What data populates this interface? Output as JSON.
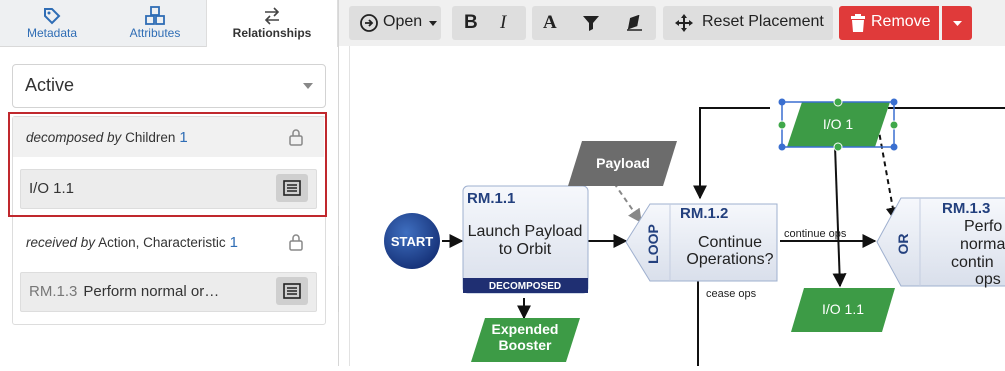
{
  "tabs": [
    {
      "label": "Metadata",
      "icon": "tag-icon"
    },
    {
      "label": "Attributes",
      "icon": "cubes-icon"
    },
    {
      "label": "Relationships",
      "icon": "swap-arrows-icon",
      "active": true
    }
  ],
  "filter": {
    "selected": "Active"
  },
  "relationships": [
    {
      "verb": "decomposed by",
      "target": "Children",
      "count": "1",
      "items": [
        {
          "id": "",
          "name": "I/O 1.1"
        }
      ]
    },
    {
      "verb": "received by",
      "target": "Action, Characteristic",
      "count": "1",
      "items": [
        {
          "id": "RM.1.3",
          "name": "Perform normal or…"
        }
      ]
    }
  ],
  "toolbar": {
    "open_label": "Open",
    "reset_label": "Reset Placement",
    "remove_label": "Remove",
    "bold_label": "B",
    "italic_label": "I",
    "font_label": "A"
  },
  "diagram": {
    "start": "START",
    "payload": "Payload",
    "io1": "I/O 1",
    "io11": "I/O 1.1",
    "expended_1": "Expended",
    "expended_2": "Booster",
    "rm11_id": "RM.1.1",
    "rm11_l1": "Launch Payload",
    "rm11_l2": "to Orbit",
    "rm11_badge": "DECOMPOSED",
    "rm12_id": "RM.1.2",
    "rm12_l1": "Continue",
    "rm12_l2": "Operations?",
    "rm12_side": "LOOP",
    "rm13_id": "RM.1.3",
    "rm13_l1": "Perfo",
    "rm13_l2": "norma",
    "rm13_l3": "contin",
    "rm13_l4": "ops",
    "rm13_side": "OR",
    "continue_ops": "continue ops",
    "cease_ops": "cease ops"
  }
}
